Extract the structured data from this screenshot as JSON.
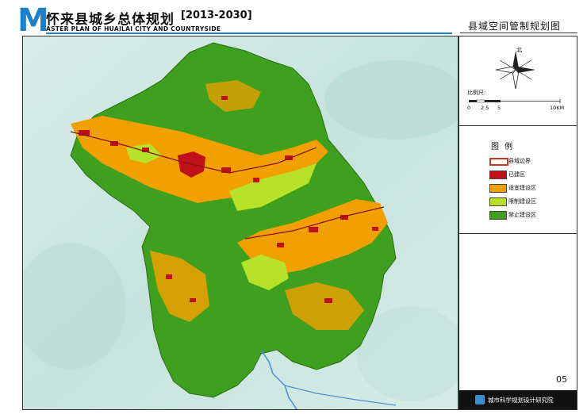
{
  "header": {
    "logo_letter": "M",
    "title_cn": "怀来县城乡总体规划",
    "title_years": "[2013-2030]",
    "title_en": "ASTER PLAN OF HUAILAI CITY AND COUNTRYSIDE"
  },
  "map_title": "县域空间管制规划图",
  "compass": {
    "north_label": "北"
  },
  "scale": {
    "label": "比例尺:",
    "ticks": [
      "0",
      "2.5",
      "5",
      "10KM"
    ]
  },
  "legend": {
    "title": "图 例",
    "items": [
      {
        "label": "县域边界",
        "color": "#ffffff",
        "border": "#c0392b"
      },
      {
        "label": "已建区",
        "color": "#c0101a"
      },
      {
        "label": "适宜建设区",
        "color": "#f0a000"
      },
      {
        "label": "限制建设区",
        "color": "#b8e22a"
      },
      {
        "label": "禁止建设区",
        "color": "#3f9f1e"
      }
    ]
  },
  "page_number": "05",
  "footer": {
    "org": "城市科学规划设计研究院"
  },
  "colors": {
    "accent": "#1c7fc9",
    "built": "#c0101a",
    "suitable": "#f0a000",
    "restricted": "#b8e22a",
    "prohibited": "#3f9f1e",
    "water": "#4a8fd6",
    "terrain": "#cfe8e3"
  }
}
